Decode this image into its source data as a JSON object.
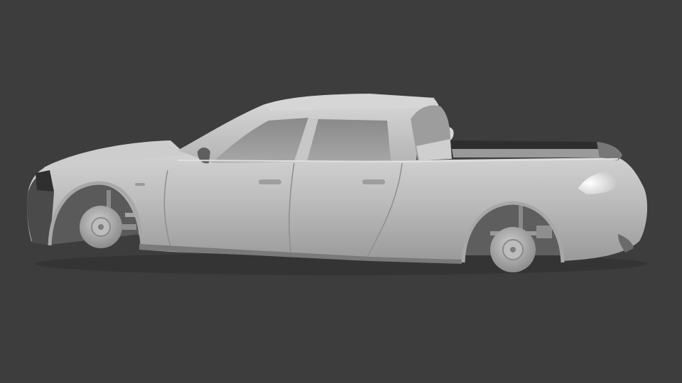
{
  "scene": {
    "subject": "car-render",
    "background_color": "#3d3d3d",
    "body_color": "#b9b9b9",
    "shadow_color": "#6e6e6e",
    "window_color": "#8f8f8f",
    "light_color": "#f4f4f4"
  }
}
